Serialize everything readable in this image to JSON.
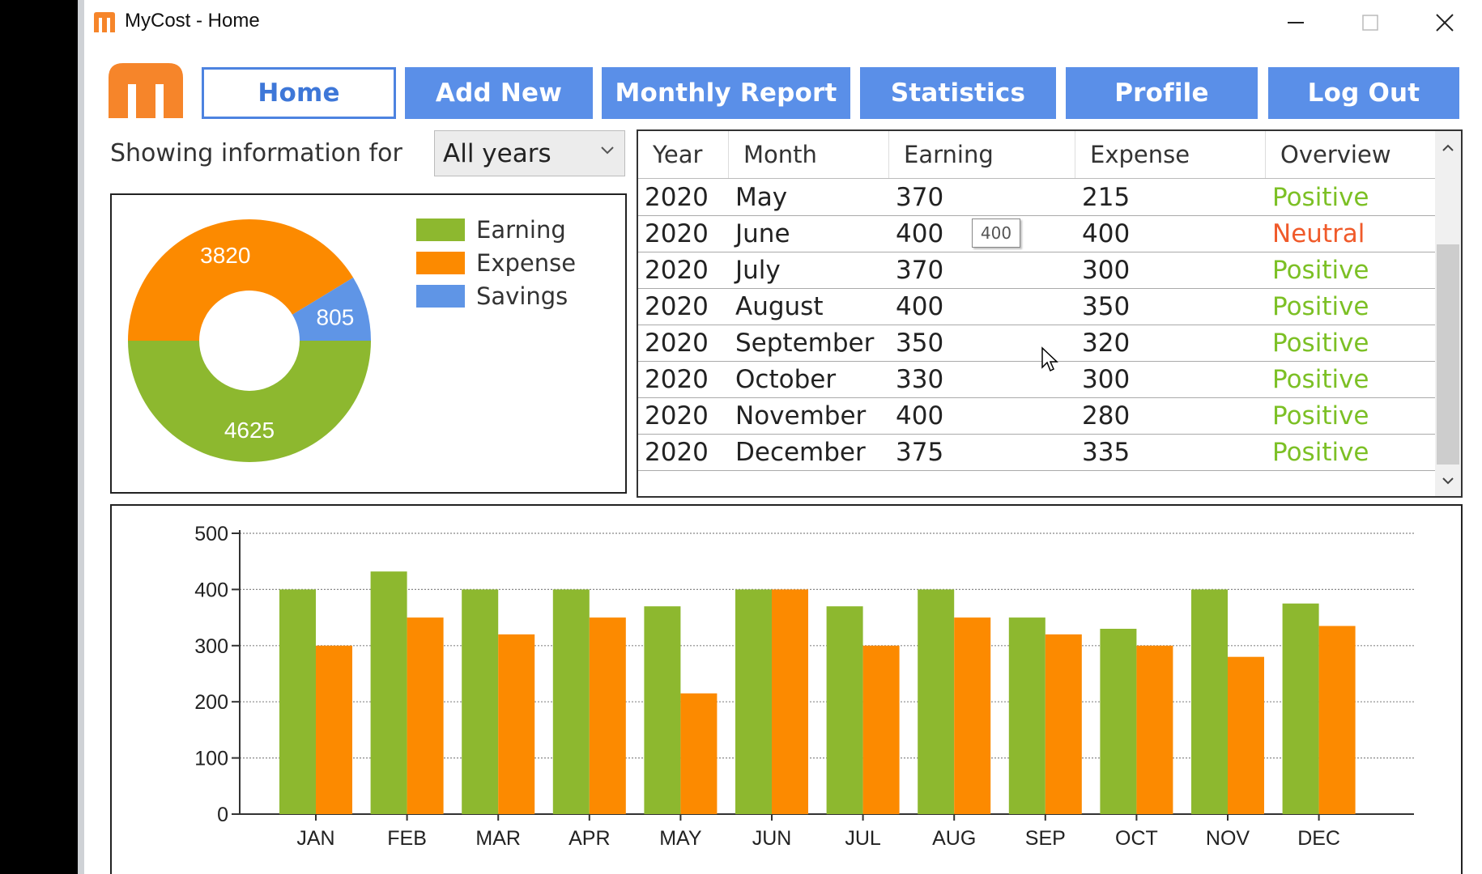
{
  "window": {
    "title": "MyCost - Home"
  },
  "nav": [
    {
      "label": "Home",
      "active": true
    },
    {
      "label": "Add New",
      "active": false
    },
    {
      "label": "Monthly Report",
      "active": false
    },
    {
      "label": "Statistics",
      "active": false
    },
    {
      "label": "Profile",
      "active": false
    },
    {
      "label": "Log Out",
      "active": false
    }
  ],
  "filter": {
    "label": "Showing information for",
    "selected": "All years"
  },
  "donut": {
    "legend": [
      "Earning",
      "Expense",
      "Savings"
    ],
    "values": {
      "earning": 4625,
      "expense": 3820,
      "savings": 805
    },
    "labels": {
      "earning": "4625",
      "expense": "3820",
      "savings": "805"
    }
  },
  "table": {
    "headers": [
      "Year",
      "Month",
      "Earning",
      "Expense",
      "Overview"
    ],
    "rows": [
      [
        "2020",
        "May",
        "370",
        "215",
        "Positive"
      ],
      [
        "2020",
        "June",
        "400",
        "400",
        "Neutral"
      ],
      [
        "2020",
        "July",
        "370",
        "300",
        "Positive"
      ],
      [
        "2020",
        "August",
        "400",
        "350",
        "Positive"
      ],
      [
        "2020",
        "September",
        "350",
        "320",
        "Positive"
      ],
      [
        "2020",
        "October",
        "330",
        "300",
        "Positive"
      ],
      [
        "2020",
        "November",
        "400",
        "280",
        "Positive"
      ],
      [
        "2020",
        "December",
        "375",
        "335",
        "Positive"
      ]
    ],
    "tooltip": "400"
  },
  "colors": {
    "earning": "#8db82f",
    "expense": "#fc8a00",
    "savings": "#5f95e6",
    "nav": "#5a8fe8",
    "positive": "#7cc025",
    "neutral": "#f05a2a",
    "logo": "#f6852a"
  },
  "chart_data": {
    "type": "bar",
    "categories": [
      "JAN",
      "FEB",
      "MAR",
      "APR",
      "MAY",
      "JUN",
      "JUL",
      "AUG",
      "SEP",
      "OCT",
      "NOV",
      "DEC"
    ],
    "series": [
      {
        "values": [
          400,
          432,
          400,
          400,
          370,
          400,
          370,
          400,
          350,
          330,
          400,
          375
        ]
      },
      {
        "values": [
          300,
          350,
          320,
          350,
          215,
          400,
          300,
          350,
          320,
          300,
          280,
          335
        ]
      }
    ],
    "yticks": [
      "0",
      "100",
      "200",
      "300",
      "400",
      "500"
    ],
    "ylim": [
      0,
      500
    ],
    "grid": true
  }
}
